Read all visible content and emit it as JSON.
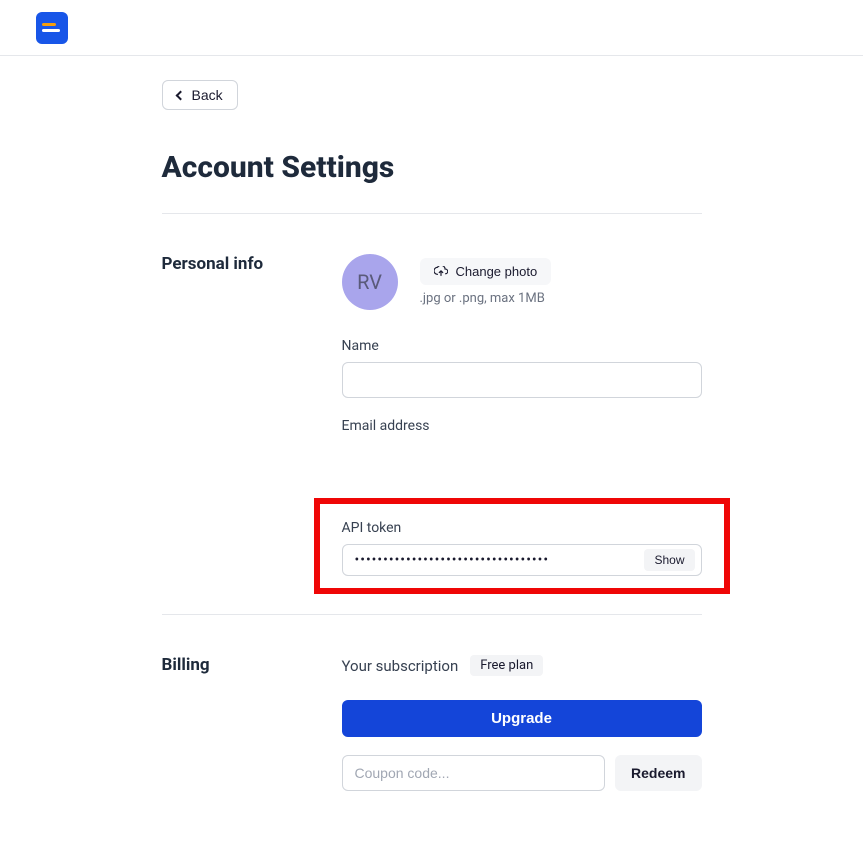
{
  "nav": {
    "back_label": "Back"
  },
  "page": {
    "title": "Account Settings"
  },
  "personal": {
    "section_label": "Personal info",
    "avatar_initials": "RV",
    "change_photo_label": "Change photo",
    "photo_hint": ".jpg or .png, max 1MB",
    "name_label": "Name",
    "name_value": "",
    "email_label": "Email address",
    "email_value": "",
    "api_token_label": "API token",
    "api_token_masked": "••••••••••••••••••••••••••••••••••",
    "show_label": "Show"
  },
  "billing": {
    "section_label": "Billing",
    "subscription_label": "Your subscription",
    "plan_badge": "Free plan",
    "upgrade_label": "Upgrade",
    "coupon_placeholder": "Coupon code...",
    "coupon_value": "",
    "redeem_label": "Redeem"
  }
}
